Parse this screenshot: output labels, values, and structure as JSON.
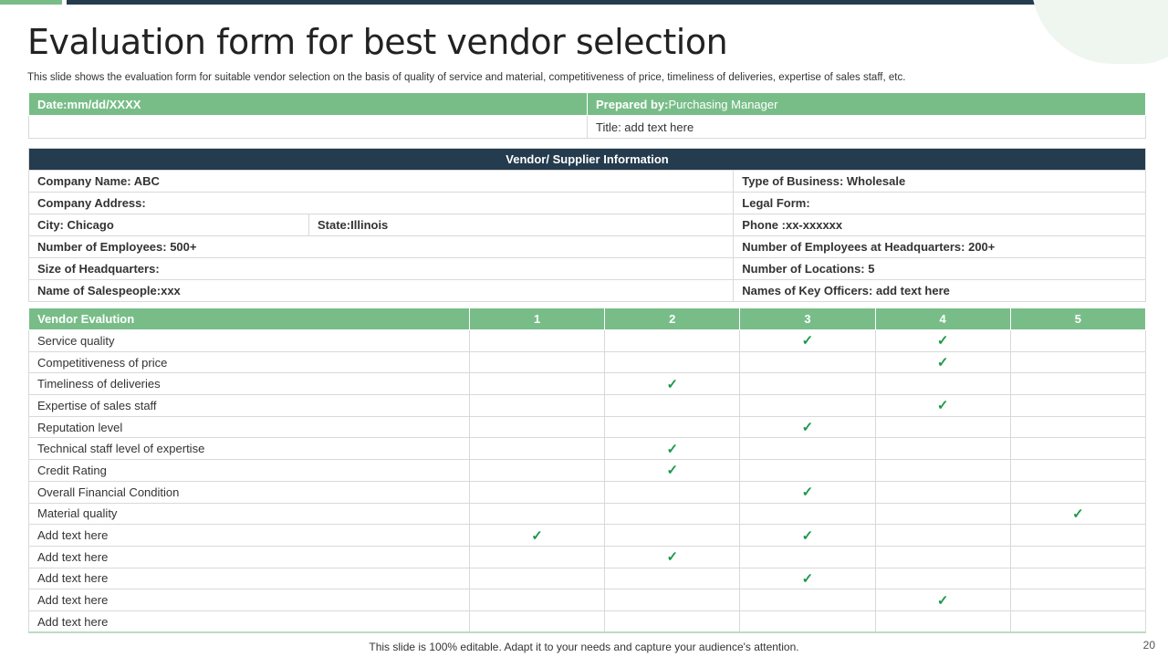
{
  "title": "Evaluation form for best vendor selection",
  "subtitle": "This slide shows the evaluation form for suitable vendor selection on the basis of quality of service and material, competitiveness of price, timeliness of deliveries, expertise of sales staff, etc.",
  "header": {
    "date": "Date:mm/dd/XXXX",
    "prepared_label": "Prepared by:",
    "prepared_value": "Purchasing Manager",
    "title_field": "Title: add text here"
  },
  "vendor": {
    "heading": "Vendor/ Supplier Information",
    "company_name": "Company Name: ABC",
    "business_type": "Type of Business:  Wholesale",
    "address": "Company Address:",
    "legal_form": "Legal Form:",
    "city": "City: Chicago",
    "state": "State:Illinois",
    "phone": "Phone :xx-xxxxxx",
    "employees": "Number of Employees: 500+",
    "employees_hq": "Number of Employees at Headquarters: 200+",
    "hq_size": "Size of Headquarters:",
    "locations": "Number of Locations:  5",
    "salespeople": "Name of Salespeople:xxx",
    "key_officers": "Names of Key Officers:  add text here"
  },
  "evaluation": {
    "heading": "Vendor Evalution",
    "columns": [
      "1",
      "2",
      "3",
      "4",
      "5"
    ],
    "check": "✓",
    "rows": [
      {
        "label": "Service  quality",
        "checks": [
          3,
          4
        ]
      },
      {
        "label": "Competitiveness  of price",
        "checks": [
          4
        ]
      },
      {
        "label": "Timeliness of deliveries",
        "checks": [
          2
        ]
      },
      {
        "label": "Expertise of sales staff",
        "checks": [
          4
        ]
      },
      {
        "label": "Reputation  level",
        "checks": [
          3
        ]
      },
      {
        "label": "Technical staff level  of expertise",
        "checks": [
          2
        ]
      },
      {
        "label": "Credit Rating",
        "checks": [
          2
        ]
      },
      {
        "label": "Overall  Financial Condition",
        "checks": [
          3
        ]
      },
      {
        "label": "Material quality",
        "checks": [
          5
        ]
      },
      {
        "label": "Add text here",
        "checks": [
          1,
          3
        ]
      },
      {
        "label": "Add text here",
        "checks": [
          2
        ]
      },
      {
        "label": "Add text here",
        "checks": [
          3
        ]
      },
      {
        "label": "Add text here",
        "checks": [
          4
        ]
      },
      {
        "label": "Add text here",
        "checks": []
      }
    ]
  },
  "footer": "This slide is 100% editable. Adapt it to your needs and capture your audience's attention.",
  "page_number": "20",
  "colors": {
    "green": "#78bd88",
    "navy": "#253b4e",
    "check": "#1a9a4a"
  }
}
